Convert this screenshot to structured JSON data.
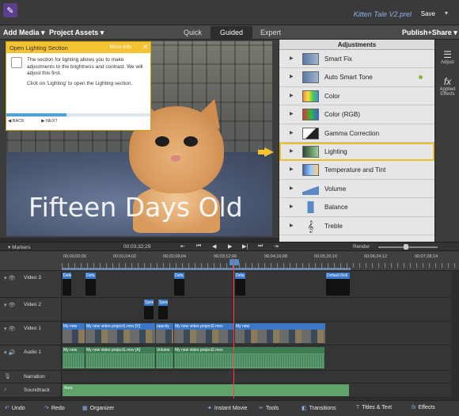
{
  "window": {
    "title": "Kitten Tale V2.prel",
    "save_label": "Save"
  },
  "menu": {
    "add_media": "Add Media",
    "project_assets": "Project Assets",
    "publish_share": "Publish+Share"
  },
  "modes": {
    "quick": "Quick",
    "guided": "Guided",
    "expert": "Expert"
  },
  "guide": {
    "title": "Open Lighting Section",
    "more_info": "More Info",
    "paragraph1": "The section for lighting allows you to make adjustments to the brightness and contrast. We will adjust this first.",
    "paragraph2": "Click on 'Lighting' to open the Lighting section.",
    "back": "BACK",
    "next": "NEXT",
    "progress": 0.42
  },
  "preview": {
    "overlay_text": "Fifteen Days Old"
  },
  "adjustments": {
    "title": "Adjustments",
    "items": [
      {
        "label": "Smart Fix"
      },
      {
        "label": "Auto Smart Tone"
      },
      {
        "label": "Color"
      },
      {
        "label": "Color (RGB)"
      },
      {
        "label": "Gamma Correction"
      },
      {
        "label": "Lighting"
      },
      {
        "label": "Temperature and Tint"
      },
      {
        "label": "Volume"
      },
      {
        "label": "Balance"
      },
      {
        "label": "Treble"
      }
    ]
  },
  "side_panel": {
    "adjust": "Adjust",
    "applied_effects": "Applied Effects"
  },
  "transport": {
    "markers": "Markers",
    "timecode": "00;03;32;29",
    "render": "Render"
  },
  "ruler": {
    "marks": [
      "00;00;00;00",
      "00;01;04;02",
      "00;02;08;04",
      "00;03;12;06",
      "00;04;16;08",
      "00;05;20;10",
      "00;06;24;12",
      "00;07;28;14"
    ]
  },
  "tracks": {
    "video3": "Video 3",
    "video2": "Video 2",
    "video1": "Video 1",
    "audio1": "Audio 1",
    "narration": "Narration",
    "soundtrack": "Soundtrack",
    "title_clip_1": "Defa",
    "title_clip_2": "Defa",
    "title_clip_3": "Defa",
    "title_clip_4": "Defa",
    "title_clip_5": "Default Roll",
    "v2_clip_1": "Spee",
    "v2_clip_2": "Spee",
    "v1_clip_1": "My new",
    "v1_clip_2": "My new video project1.mov [V]",
    "v1_clip_3": "opacity",
    "v1_clip_4": "My new video project2.mov",
    "v1_clip_5": "My new",
    "a1_clip_1": "My new",
    "a1_clip_2": "My new video project1.mov [A]",
    "a1_clip_3": "Volume",
    "a1_clip_4": "My new video project2.mov",
    "soundtrack_clip": "Aura"
  },
  "actions": {
    "undo": "Undo",
    "redo": "Redo",
    "organizer": "Organizer",
    "instant_movie": "Instant Movie",
    "tools": "Tools",
    "transitions": "Transitions",
    "titles_text": "Titles & Text",
    "effects": "Effects"
  }
}
